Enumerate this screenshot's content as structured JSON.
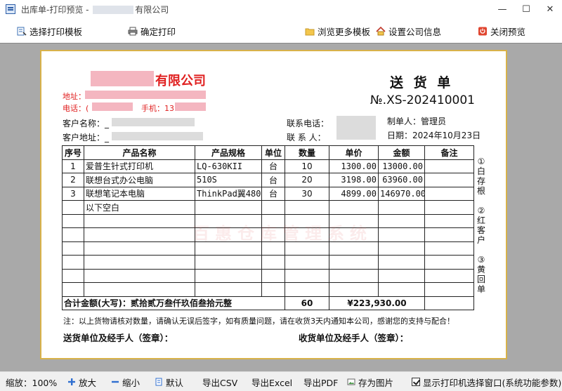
{
  "window": {
    "title_prefix": "出库单-打印预览 - ",
    "title_suffix": "有限公司",
    "minimize": "—",
    "maximize": "☐",
    "close": "✕"
  },
  "toolbar": {
    "select_template": "选择打印模板",
    "confirm_print": "确定打印",
    "browse_templates": "浏览更多模板",
    "company_info": "设置公司信息",
    "close_preview": "关闭预览"
  },
  "doc": {
    "company_suffix": "有限公司",
    "title": "送 货 单",
    "number": "№.XS-202410001",
    "address_label": "地址：",
    "phone_label": "电话：(",
    "mobile_label": "手机：13",
    "customer_name_label": "客户名称：_",
    "customer_addr_label": "客户地址：_",
    "contact_phone_label": "联系电话：",
    "contact_person_label": "联 系 人：",
    "maker": "制单人：管理员",
    "date": "日期：2024年10月23日",
    "headers": [
      "序号",
      "产品名称",
      "产品规格",
      "单位",
      "数量",
      "单价",
      "金额",
      "备注"
    ],
    "rows": [
      [
        "1",
        "爱普生针式打印机",
        "LQ-630KII",
        "台",
        "10",
        "1300.00",
        "13000.00",
        ""
      ],
      [
        "2",
        "联想台式办公电脑",
        "510S",
        "台",
        "20",
        "3198.00",
        "63960.00",
        ""
      ],
      [
        "3",
        "联想笔记本电脑",
        "ThinkPad翼480",
        "台",
        "30",
        "4899.00",
        "146970.00",
        ""
      ],
      [
        "",
        "以下空白",
        "",
        "",
        "",
        "",
        "",
        ""
      ],
      [
        "",
        "",
        "",
        "",
        "",
        "",
        "",
        ""
      ],
      [
        "",
        "",
        "",
        "",
        "",
        "",
        "",
        ""
      ],
      [
        "",
        "",
        "",
        "",
        "",
        "",
        "",
        ""
      ],
      [
        "",
        "",
        "",
        "",
        "",
        "",
        "",
        ""
      ],
      [
        "",
        "",
        "",
        "",
        "",
        "",
        "",
        ""
      ],
      [
        "",
        "",
        "",
        "",
        "",
        "",
        "",
        ""
      ]
    ],
    "total_label": "合计金额(大写)：贰拾贰万叁仟玖佰叁拾元整",
    "total_qty": "60",
    "total_amount": "¥223,930.00",
    "side_note_1": [
      "①",
      "白",
      "存",
      "根"
    ],
    "side_note_2": [
      "②",
      "红",
      "客",
      "户"
    ],
    "side_note_3": [
      "③",
      "黄",
      "回",
      "单"
    ],
    "watermark": "百惠仓库管理系统",
    "note": "注：以上货物请核对数量，请确认无误后签字，如有质量问题，请在收货3天内通知本公司，感谢您的支持与配合！",
    "sender_sign": "送货单位及经手人（签章）：",
    "receiver_sign": "收货单位及经手人（签章）："
  },
  "statusbar": {
    "zoom": "缩放：100%",
    "zoom_in": "放大",
    "zoom_out": "缩小",
    "default": "默认",
    "export_csv": "导出CSV",
    "export_excel": "导出Excel",
    "export_pdf": "导出PDF",
    "save_image": "存为图片",
    "show_printer": "显示打印机选择窗口(系统功能参数)"
  },
  "colors": {
    "company_red": "#e02020",
    "paper_border": "#d8b24a",
    "canvas_gray": "#a9a9a9"
  }
}
